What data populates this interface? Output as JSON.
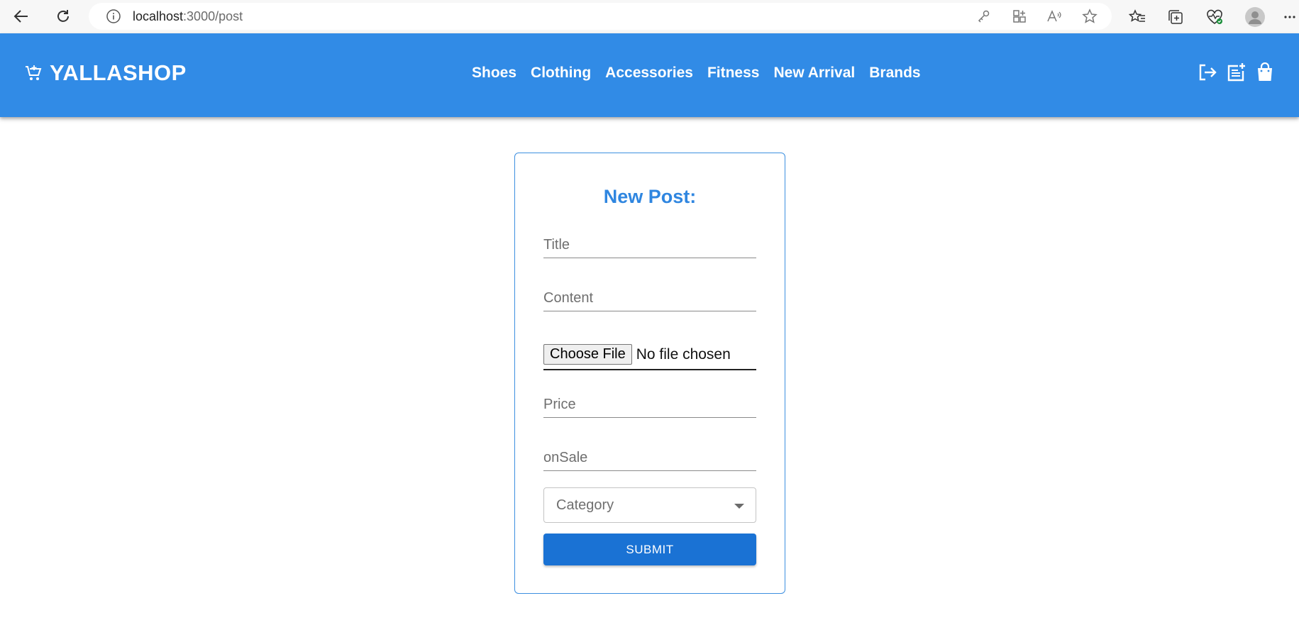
{
  "browser": {
    "url_host": "localhost",
    "url_path": ":3000/post",
    "icons": [
      "back-icon",
      "refresh-icon",
      "info-icon",
      "key-icon",
      "app-available-icon",
      "read-aloud-icon",
      "favorite-star-icon",
      "favorites-icon",
      "collections-icon",
      "browser-essentials-icon",
      "profile-avatar-icon",
      "more-icon"
    ]
  },
  "header": {
    "brand": "YALLASHOP",
    "nav": [
      "Shoes",
      "Clothing",
      "Accessories",
      "Fitness",
      "New Arrival",
      "Brands"
    ],
    "actions": [
      "logout-icon",
      "post-add-icon",
      "shopping-bag-icon"
    ],
    "bg_color": "#318be6"
  },
  "form": {
    "title": "New Post:",
    "title_placeholder": "Title",
    "content_placeholder": "Content",
    "file_button": "Choose File",
    "file_status": "No file chosen",
    "price_placeholder": "Price",
    "onsale_placeholder": "onSale",
    "category_value": "Category",
    "submit_label": "SUBMIT",
    "accent_color": "#1a72d4"
  }
}
